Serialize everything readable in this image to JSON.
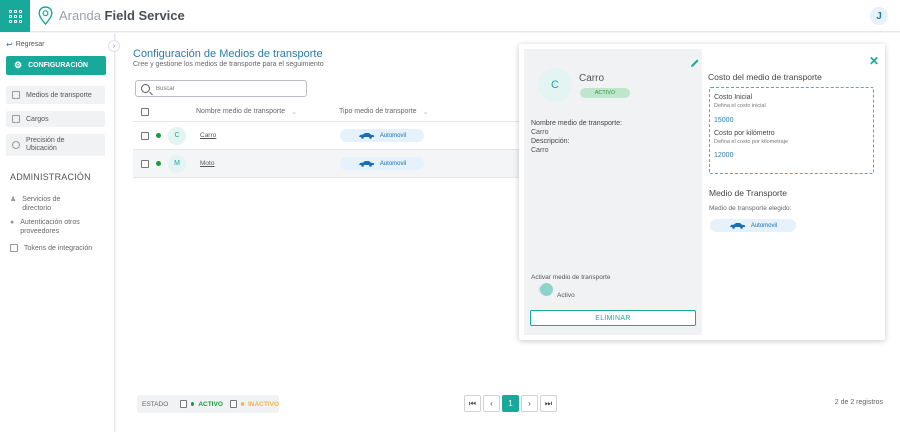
{
  "app": {
    "brand_light": "Aranda",
    "brand_bold": "Field Service",
    "user_initial": "J"
  },
  "sidebar": {
    "back_label": "Regresar",
    "config_label": "CONFIGURACIÓN",
    "items": [
      {
        "label": "Medios de transporte"
      },
      {
        "label": "Cargos"
      },
      {
        "label": "Precisión de Ubicación"
      }
    ],
    "admin_title": "ADMINISTRACIÓN",
    "admin_items": [
      {
        "label": "Servicios de directorio"
      },
      {
        "label": "Autenticación otros proveedores"
      },
      {
        "label": "Tokens de integración"
      }
    ]
  },
  "main": {
    "title": "Configuración de Medios de transporte",
    "subtitle": "Cree y gestione los medios de transporte para el seguimiento",
    "search_placeholder": "Buscar",
    "columns": {
      "name": "Nombre medio de transporte",
      "type": "Tipo medio de transporte"
    },
    "rows": [
      {
        "initial": "C",
        "name": "Carro",
        "type": "Automovil"
      },
      {
        "initial": "M",
        "name": "Moto",
        "type": "Automovil"
      }
    ]
  },
  "footer": {
    "estado_label": "ESTADO",
    "activo_label": "ACTIVO",
    "inactivo_label": "INACTIVO",
    "current_page": "1",
    "records": "2 de 2 registros"
  },
  "detail": {
    "initial": "C",
    "name": "Carro",
    "status": "ACTIVO",
    "name_label": "Nombre medio de transporte:",
    "name_value": "Carro",
    "desc_label": "Descripción:",
    "desc_value": "Carro",
    "activate_label": "Activar medio de transporte",
    "toggle_label": "Activo",
    "delete_label": "ELIMINAR",
    "cost_title": "Costo del medio de transporte",
    "initial_cost_label": "Costo Inicial",
    "initial_cost_help": "Defina el costo inicial",
    "initial_cost_value": "15000",
    "km_cost_label": "Costo por kilómetro",
    "km_cost_help": "Defina el costo por kilometraje",
    "km_cost_value": "12000",
    "mt_title": "Medio de Transporte",
    "mt_sub": "Medio de transporte elegido:",
    "mt_value": "Automovil"
  },
  "colors": {
    "accent": "#17a99a",
    "link": "#2a7ca8",
    "active_green": "#1f9a3a",
    "inactive_yellow": "#f3b54a"
  }
}
